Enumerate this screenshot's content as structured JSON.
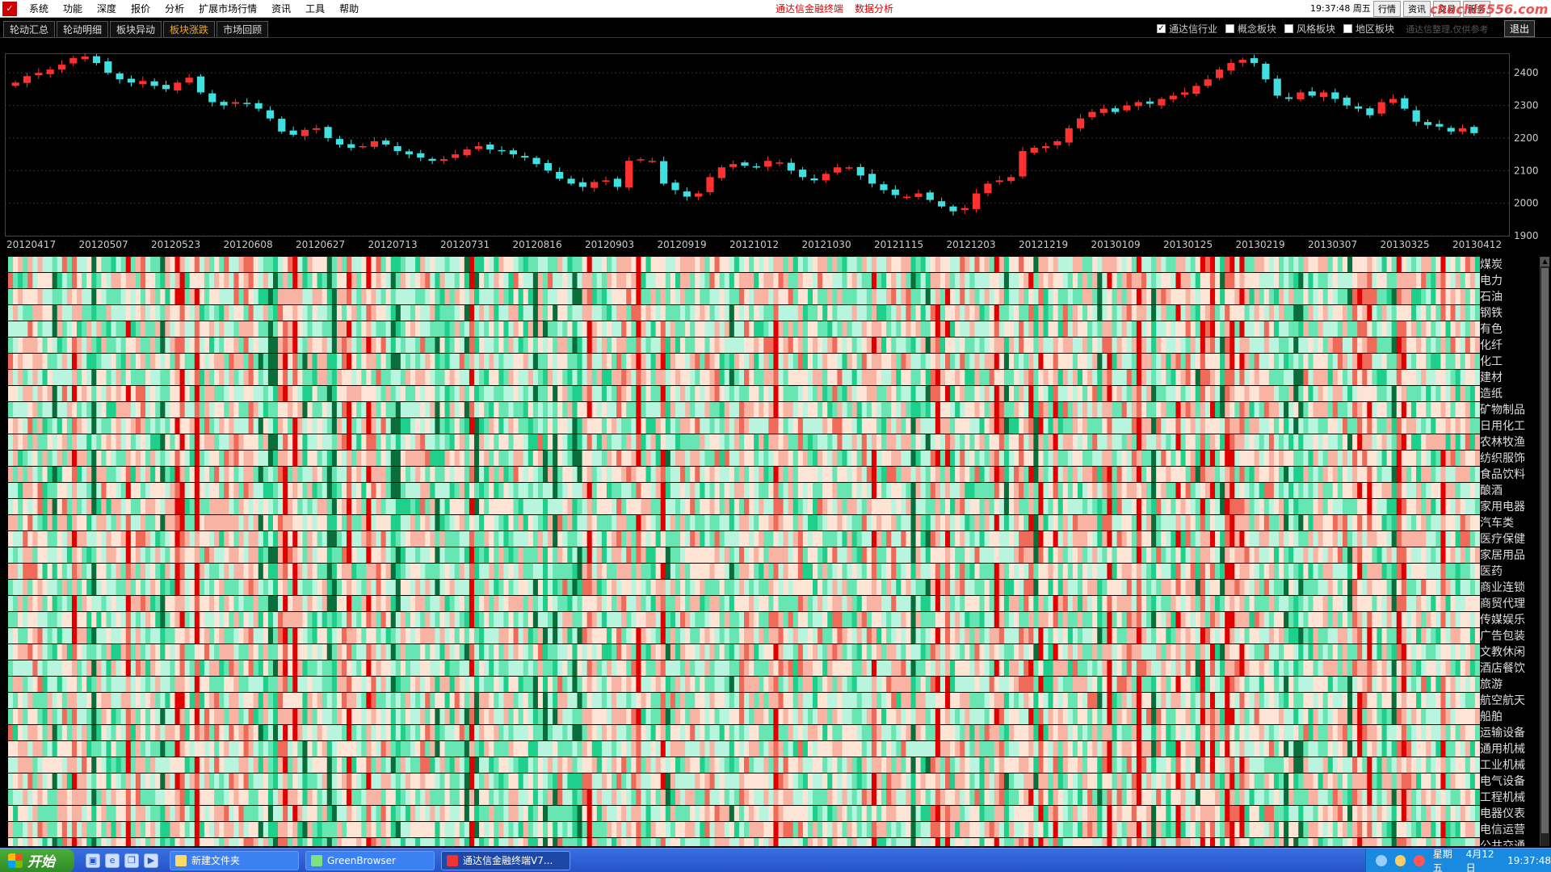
{
  "menubar": {
    "items": [
      "系统",
      "功能",
      "深度",
      "报价",
      "分析",
      "扩展市场行情",
      "资讯",
      "工具",
      "帮助"
    ],
    "title_left": "通达信金融终端",
    "title_right": "数据分析",
    "clock": "19:37:48 周五",
    "right_buttons": [
      "行情",
      "资讯",
      "交易",
      "服务"
    ],
    "watermark": "chuchi5556.com"
  },
  "tabs": {
    "items": [
      "轮动汇总",
      "轮动明细",
      "板块异动",
      "板块涨跌",
      "市场回顾"
    ],
    "active_index": 3
  },
  "filters": {
    "items": [
      {
        "label": "通达信行业",
        "checked": true
      },
      {
        "label": "概念板块",
        "checked": false
      },
      {
        "label": "风格板块",
        "checked": false
      },
      {
        "label": "地区板块",
        "checked": false
      }
    ],
    "hint": "通达信整理,仅供参考",
    "exit_label": "退出"
  },
  "chart_data": {
    "type": "candlestick",
    "title": "",
    "xlabel": "",
    "ylabel": "",
    "ylim": [
      1900,
      2460
    ],
    "y_ticks": [
      "2400",
      "2300",
      "2200",
      "2100",
      "2000",
      "1900"
    ],
    "x_ticks": [
      "20120417",
      "20120507",
      "20120523",
      "20120608",
      "20120627",
      "20120713",
      "20120731",
      "20120816",
      "20120903",
      "20120919",
      "20121012",
      "20121030",
      "20121115",
      "20121203",
      "20121219",
      "20130109",
      "20130125",
      "20130219",
      "20130307",
      "20130325",
      "20130412"
    ],
    "up_color": "#ff3030",
    "down_color": "#40e0e0",
    "closes": [
      2370,
      2390,
      2400,
      2410,
      2425,
      2445,
      2450,
      2430,
      2400,
      2380,
      2370,
      2375,
      2360,
      2350,
      2370,
      2385,
      2340,
      2310,
      2300,
      2310,
      2305,
      2290,
      2260,
      2220,
      2210,
      2225,
      2230,
      2200,
      2180,
      2170,
      2175,
      2190,
      2180,
      2160,
      2150,
      2140,
      2130,
      2135,
      2150,
      2165,
      2175,
      2165,
      2160,
      2150,
      2140,
      2120,
      2100,
      2075,
      2060,
      2050,
      2065,
      2070,
      2050,
      2130,
      2135,
      2130,
      2060,
      2040,
      2020,
      2030,
      2080,
      2110,
      2120,
      2115,
      2110,
      2130,
      2125,
      2100,
      2080,
      2070,
      2090,
      2110,
      2110,
      2085,
      2060,
      2040,
      2025,
      2020,
      2030,
      2010,
      1990,
      1975,
      1985,
      2030,
      2060,
      2070,
      2080,
      2160,
      2170,
      2175,
      2190,
      2230,
      2260,
      2280,
      2290,
      2280,
      2300,
      2310,
      2305,
      2320,
      2330,
      2340,
      2360,
      2380,
      2410,
      2430,
      2440,
      2430,
      2380,
      2330,
      2320,
      2340,
      2330,
      2340,
      2320,
      2300,
      2290,
      2270,
      2310,
      2320,
      2290,
      2250,
      2240,
      2235,
      2220,
      2230,
      2215
    ]
  },
  "sectors": [
    "煤炭",
    "电力",
    "石油",
    "钢铁",
    "有色",
    "化纤",
    "化工",
    "建材",
    "造纸",
    "矿物制品",
    "日用化工",
    "农林牧渔",
    "纺织服饰",
    "食品饮料",
    "酿酒",
    "家用电器",
    "汽车类",
    "医疗保健",
    "家居用品",
    "医药",
    "商业连锁",
    "商贸代理",
    "传媒娱乐",
    "广告包装",
    "文教休闲",
    "酒店餐饮",
    "旅游",
    "航空航天",
    "船舶",
    "运输设备",
    "通用机械",
    "工业机械",
    "电气设备",
    "工程机械",
    "电器仪表",
    "电信运营",
    "公共交通"
  ],
  "heatmap": {
    "columns": 300,
    "palette": [
      "#e00000",
      "#f06a5a",
      "#f9b3a3",
      "#fde4d4",
      "#b9f5de",
      "#67e6b4",
      "#1fcf8c",
      "#0a6e3c"
    ]
  },
  "taskbar": {
    "start_label": "开始",
    "tasks": [
      "新建文件夹",
      "GreenBrowser",
      "通达信金融终端V7..."
    ],
    "active_task": 2,
    "tray_day": "星期五",
    "tray_date": "4月12日",
    "tray_time": "19:37:48"
  }
}
